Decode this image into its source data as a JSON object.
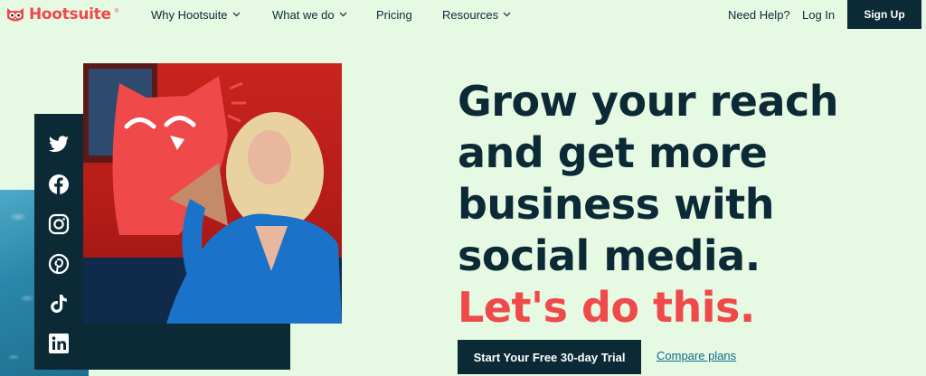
{
  "nav": {
    "brand": "Hootsuite",
    "brand_mark": "®",
    "items": [
      {
        "label": "Why Hootsuite",
        "has_dropdown": true
      },
      {
        "label": "What we do",
        "has_dropdown": true
      },
      {
        "label": "Pricing",
        "has_dropdown": false
      },
      {
        "label": "Resources",
        "has_dropdown": true
      }
    ],
    "help": "Need Help?",
    "login": "Log In",
    "signup": "Sign Up"
  },
  "hero": {
    "headline_lines": [
      "Grow your reach",
      "and get more",
      "business with",
      "social media."
    ],
    "headline_accent": "Let's do this.",
    "cta_primary": "Start Your Free 30-day Trial",
    "cta_secondary": "Compare plans",
    "social_icons": [
      "twitter-icon",
      "facebook-icon",
      "instagram-icon",
      "pinterest-icon",
      "tiktok-icon",
      "linkedin-icon"
    ]
  },
  "colors": {
    "background": "#e6f9e3",
    "navy": "#0b2a36",
    "accent_red": "#f0494a",
    "link": "#0b6b8a"
  }
}
